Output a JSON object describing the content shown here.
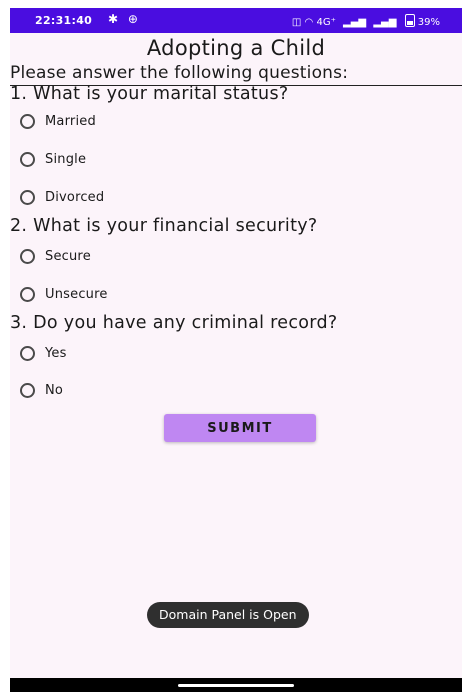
{
  "status_bar": {
    "time": "22:31:40",
    "left_icons": [
      "settings-gear-icon",
      "vpn-icon"
    ],
    "network_text": "4G⁺",
    "battery": "39%"
  },
  "screen": {
    "title": "Adopting a Child",
    "instructions": "Please answer the following questions:",
    "questions": [
      {
        "label": "1. What is your marital status?",
        "options": [
          "Married",
          "Single",
          "Divorced"
        ]
      },
      {
        "label": "2. What is your financial security?",
        "options": [
          "Secure",
          "Unsecure"
        ]
      },
      {
        "label": "3. Do you have any criminal record?",
        "options": [
          "Yes",
          "No"
        ]
      }
    ],
    "submit_label": "SUBMIT"
  },
  "toast": {
    "message": "Domain Panel is Open"
  },
  "colors": {
    "status_bar": "#4a0de0",
    "background": "#fcf4fa",
    "button": "#bf87f2",
    "toast": "#2f2f2f"
  }
}
